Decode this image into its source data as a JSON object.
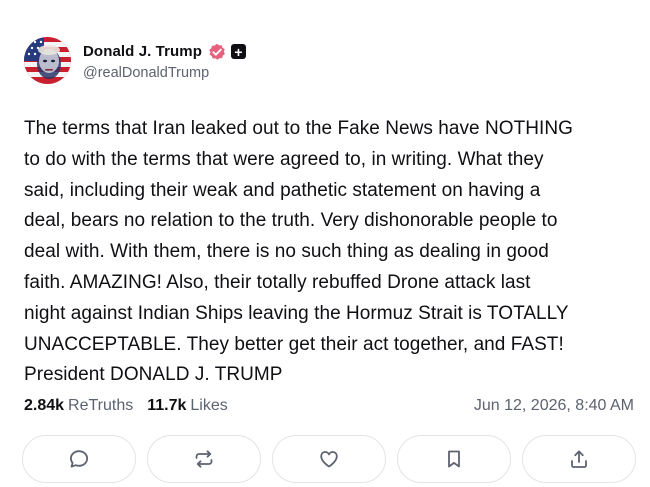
{
  "author": {
    "display_name": "Donald J. Trump",
    "handle": "@realDonaldTrump",
    "avatar_icon": "flag-portrait-avatar",
    "verified_icon": "verified-badge-icon",
    "verified_color": "#e5617c",
    "plus_badge": "+"
  },
  "post": {
    "text": "The terms that Iran leaked out to the Fake News have NOTHING\nto do with the terms that were agreed to, in writing. What they\nsaid, including their weak and pathetic statement on having a\ndeal, bears no relation to the truth. Very dishonorable people to\ndeal with. With them, there is no such thing as dealing in good\nfaith. AMAZING! Also, their totally rebuffed Drone attack last\nnight against Indian Ships leaving the Hormuz Strait is TOTALLY\nUNACCEPTABLE. They better get their act together, and FAST!\nPresident DONALD J. TRUMP"
  },
  "stats": {
    "retruths_count": "2.84k",
    "retruths_label": "ReTruths",
    "likes_count": "11.7k",
    "likes_label": "Likes",
    "timestamp": "Jun 12, 2026, 8:40 AM"
  },
  "actions": [
    {
      "icon": "reply-icon"
    },
    {
      "icon": "retruth-icon"
    },
    {
      "icon": "like-icon"
    },
    {
      "icon": "bookmark-icon"
    },
    {
      "icon": "share-icon"
    }
  ],
  "colors": {
    "text_primary": "#0f0f14",
    "text_secondary": "#5d6270",
    "border": "#e2e4ea"
  }
}
